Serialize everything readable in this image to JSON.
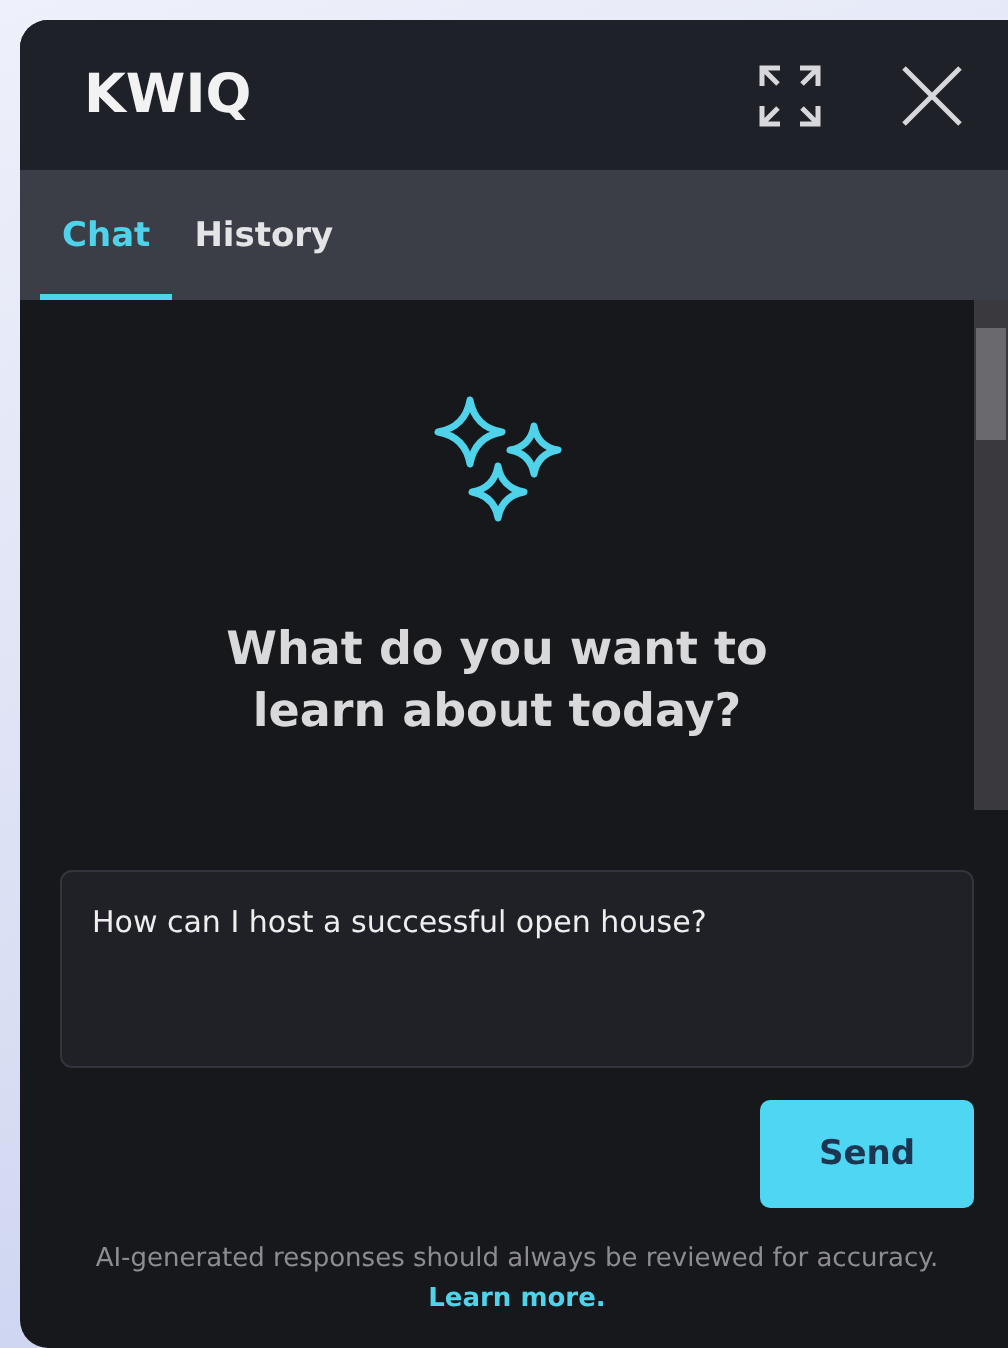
{
  "header": {
    "title": "KWIQ"
  },
  "tabs": [
    {
      "label": "Chat",
      "selected": true
    },
    {
      "label": "History",
      "selected": false
    }
  ],
  "welcome": {
    "heading": "What do you want to learn about today?"
  },
  "composer": {
    "value": "How can I host a successful open house?",
    "send_label": "Send"
  },
  "disclaimer": {
    "text": "AI-generated responses should always be reviewed for accuracy.",
    "link": "Learn more."
  }
}
